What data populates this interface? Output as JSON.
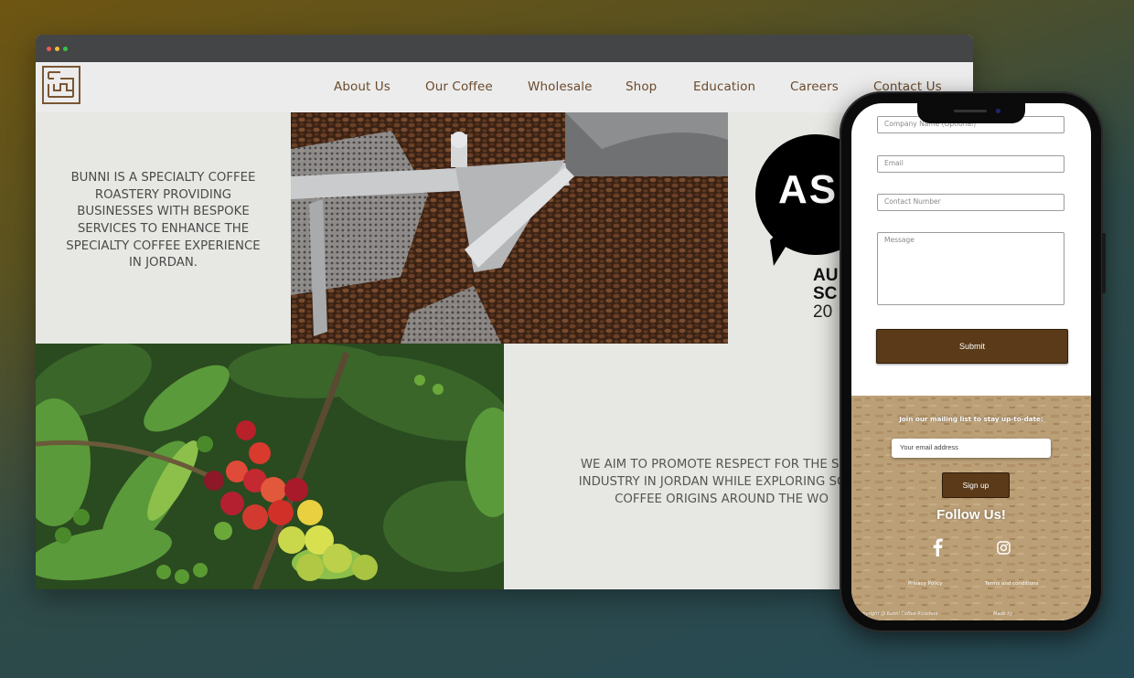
{
  "nav": {
    "items": [
      "About Us",
      "Our Coffee",
      "Wholesale",
      "Shop",
      "Education",
      "Careers",
      "Contact Us"
    ]
  },
  "intro_text": "BUNNI IS A SPECIALTY COFFEE ROASTERY PROVIDING BUSINESSES WITH BESPOKE SERVICES TO ENHANCE THE SPECIALTY COFFEE EXPERIENCE IN JORDAN.",
  "aim_text": {
    "line1": "WE AIM TO PROMOTE RESPECT FOR THE SPEC",
    "line2": "INDUSTRY IN JORDAN WHILE EXPLORING SOME",
    "line3": "COFFEE ORIGINS AROUND THE WO"
  },
  "award": {
    "logo_text": "AS",
    "line1": "AU",
    "line2": "SC",
    "line3": "20"
  },
  "form": {
    "company_placeholder": "Company Name (Optional)",
    "email_placeholder": "Email",
    "contact_placeholder": "Contact Number",
    "message_placeholder": "Message",
    "submit_label": "Submit"
  },
  "footer": {
    "join_text": "Join our mailing list to stay up-to-date:",
    "email_placeholder": "Your email address",
    "signup_label": "Sign up",
    "follow_text": "Follow Us!",
    "privacy_label": "Privacy Policy",
    "terms_label": "Terms and conditions",
    "copyright": "Copyright @ Bunni Coffee Roasters",
    "made_by": "Made by"
  },
  "colors": {
    "brand_brown": "#5a3a18",
    "nav_text": "#6a4a2c",
    "panel_bg": "#e7e8e3"
  }
}
